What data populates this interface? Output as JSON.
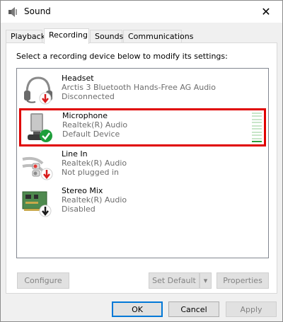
{
  "window": {
    "title": "Sound",
    "close_glyph": "✕",
    "icon": "speaker-icon"
  },
  "tabs": [
    {
      "label": "Playback",
      "active": false
    },
    {
      "label": "Recording",
      "active": true
    },
    {
      "label": "Sounds",
      "active": false
    },
    {
      "label": "Communications",
      "active": false
    }
  ],
  "instruction": "Select a recording device below to modify its settings:",
  "devices": [
    {
      "name": "Headset",
      "line1": "Arctis 3 Bluetooth Hands-Free AG Audio",
      "line2": "Disconnected",
      "icon": "headset-icon",
      "status_icon": "red-down-arrow-icon",
      "selected": false
    },
    {
      "name": "Microphone",
      "line1": "Realtek(R) Audio",
      "line2": "Default Device",
      "icon": "microphone-icon",
      "status_icon": "green-check-icon",
      "selected": true,
      "level_fraction": 0.1
    },
    {
      "name": "Line In",
      "line1": "Realtek(R) Audio",
      "line2": "Not plugged in",
      "icon": "line-in-cable-icon",
      "status_icon": "red-down-arrow-icon",
      "selected": false
    },
    {
      "name": "Stereo Mix",
      "line1": "Realtek(R) Audio",
      "line2": "Disabled",
      "icon": "sound-card-icon",
      "status_icon": "black-down-arrow-icon",
      "selected": false
    }
  ],
  "panel_buttons": {
    "configure": "Configure",
    "set_default": "Set Default",
    "dropdown_glyph": "▾",
    "properties": "Properties"
  },
  "footer_buttons": {
    "ok": "OK",
    "cancel": "Cancel",
    "apply": "Apply"
  },
  "colors": {
    "selection_border": "#e00000",
    "level_on": "#2e9e3e",
    "level_off": "#c8e6c9",
    "accent": "#0078d7"
  }
}
